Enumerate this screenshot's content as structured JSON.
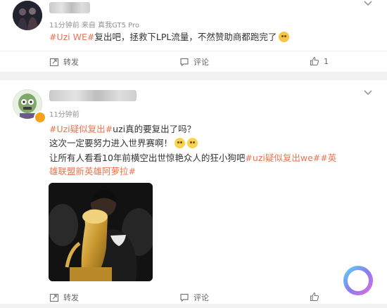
{
  "posts": [
    {
      "time_source": "11分钟前  来自 真我GT5 Pro",
      "content": {
        "tag": "#Uzi WE#",
        "text": "复出吧，拯救下LPL流量，不然赞助商都跑完了",
        "emoji": "laughing-face"
      },
      "actions": {
        "repost": "转发",
        "comment": "评论",
        "like_count": "1"
      }
    },
    {
      "time_source": "11分钟前",
      "content": {
        "line1_tag": "#Uzi疑似复出#",
        "line1_text": "uzi真的要复出了吗？",
        "line2_text": "这次一定要努力进入世界赛啊！",
        "line3_text": "让所有人看看10年前横空出世惊艳众人的狂小狗吧",
        "line3_tag1": "#uzi疑似复出we#",
        "line3_tag2": "#英雄联盟新英雄阿萝拉#"
      },
      "image": "player-holding-trophy-photo",
      "actions": {
        "repost": "转发",
        "comment": "评论"
      }
    }
  ],
  "colors": {
    "tag": "#eb7350",
    "meta": "#939393",
    "background": "#f2f2f2",
    "verified": "#f7a21b"
  }
}
